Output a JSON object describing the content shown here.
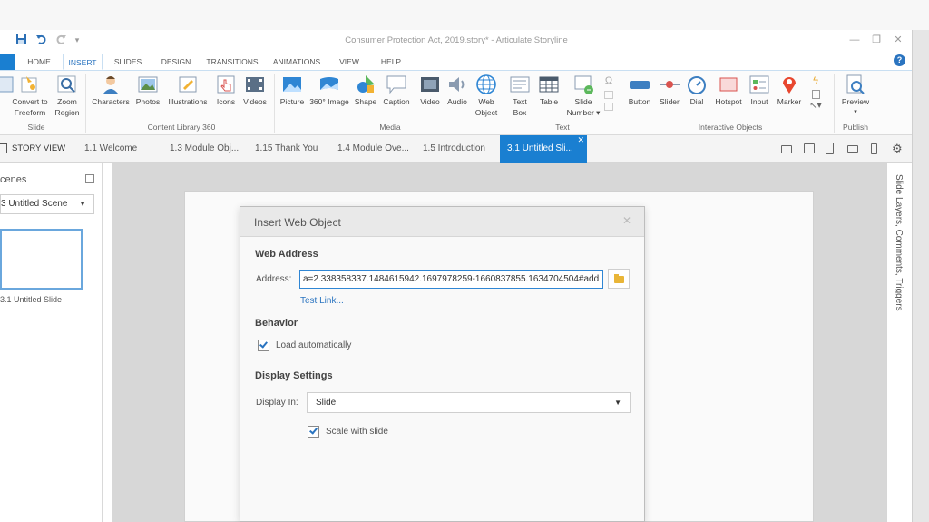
{
  "window": {
    "title": "Consumer Protection Act, 2019.story* - Articulate Storyline"
  },
  "ribbon_tabs": [
    "HOME",
    "INSERT",
    "SLIDES",
    "DESIGN",
    "TRANSITIONS",
    "ANIMATIONS",
    "VIEW",
    "HELP"
  ],
  "active_tab": "INSERT",
  "ribbon": {
    "slide_group": {
      "label": "Slide",
      "buttons": [
        {
          "line1": "Convert to",
          "line2": "Freeform",
          "icon": "convert-freeform-icon"
        },
        {
          "line1": "Zoom",
          "line2": "Region",
          "icon": "zoom-region-icon"
        }
      ]
    },
    "content_library": {
      "label": "Content Library 360",
      "buttons": [
        "Characters",
        "Photos",
        "Illustrations",
        "Icons",
        "Videos"
      ]
    },
    "media": {
      "label": "Media",
      "buttons": [
        "Picture",
        "360° Image",
        "Shape",
        "Caption"
      ]
    },
    "media2": {
      "buttons": [
        {
          "line1": "Video",
          "line2": ""
        },
        {
          "line1": "Audio",
          "line2": ""
        },
        {
          "line1": "Web",
          "line2": "Object"
        }
      ]
    },
    "text": {
      "label": "Text",
      "buttons": [
        {
          "line1": "Text",
          "line2": "Box"
        },
        {
          "line1": "Table",
          "line2": ""
        },
        {
          "line1": "Slide",
          "line2": "Number ▾"
        }
      ]
    },
    "interactive": {
      "label": "Interactive Objects",
      "buttons": [
        "Button",
        "Slider",
        "Dial",
        "Hotspot",
        "Input",
        "Marker"
      ]
    },
    "publish": {
      "label": "Publish",
      "buttons": [
        "Preview"
      ]
    }
  },
  "story_tabs": {
    "story_view": "STORY VIEW",
    "tabs": [
      "1.1 Welcome",
      "1.3 Module Obj...",
      "1.15 Thank You",
      "1.4 Module Ove...",
      "1.5 Introduction"
    ],
    "active": "3.1 Untitled Sli..."
  },
  "scenes_panel": {
    "title": "cenes",
    "selected_scene": "3 Untitled Scene",
    "thumb_label": "3.1 Untitled Slide"
  },
  "right_panel": {
    "label": "Slide Layers, Comments, Triggers"
  },
  "dialog": {
    "title": "Insert Web Object",
    "web_address_heading": "Web Address",
    "address_label": "Address:",
    "address_value": "a=2.338358337.1484615942.1697978259-1660837855.1634704504#add",
    "test_link": "Test Link...",
    "behavior_heading": "Behavior",
    "load_auto_label": "Load automatically",
    "load_auto_checked": true,
    "display_heading": "Display Settings",
    "display_in_label": "Display In:",
    "display_in_value": "Slide",
    "scale_label": "Scale with slide",
    "scale_checked": true
  },
  "colors": {
    "accent": "#1a7fd1",
    "link": "#2a74c0"
  }
}
